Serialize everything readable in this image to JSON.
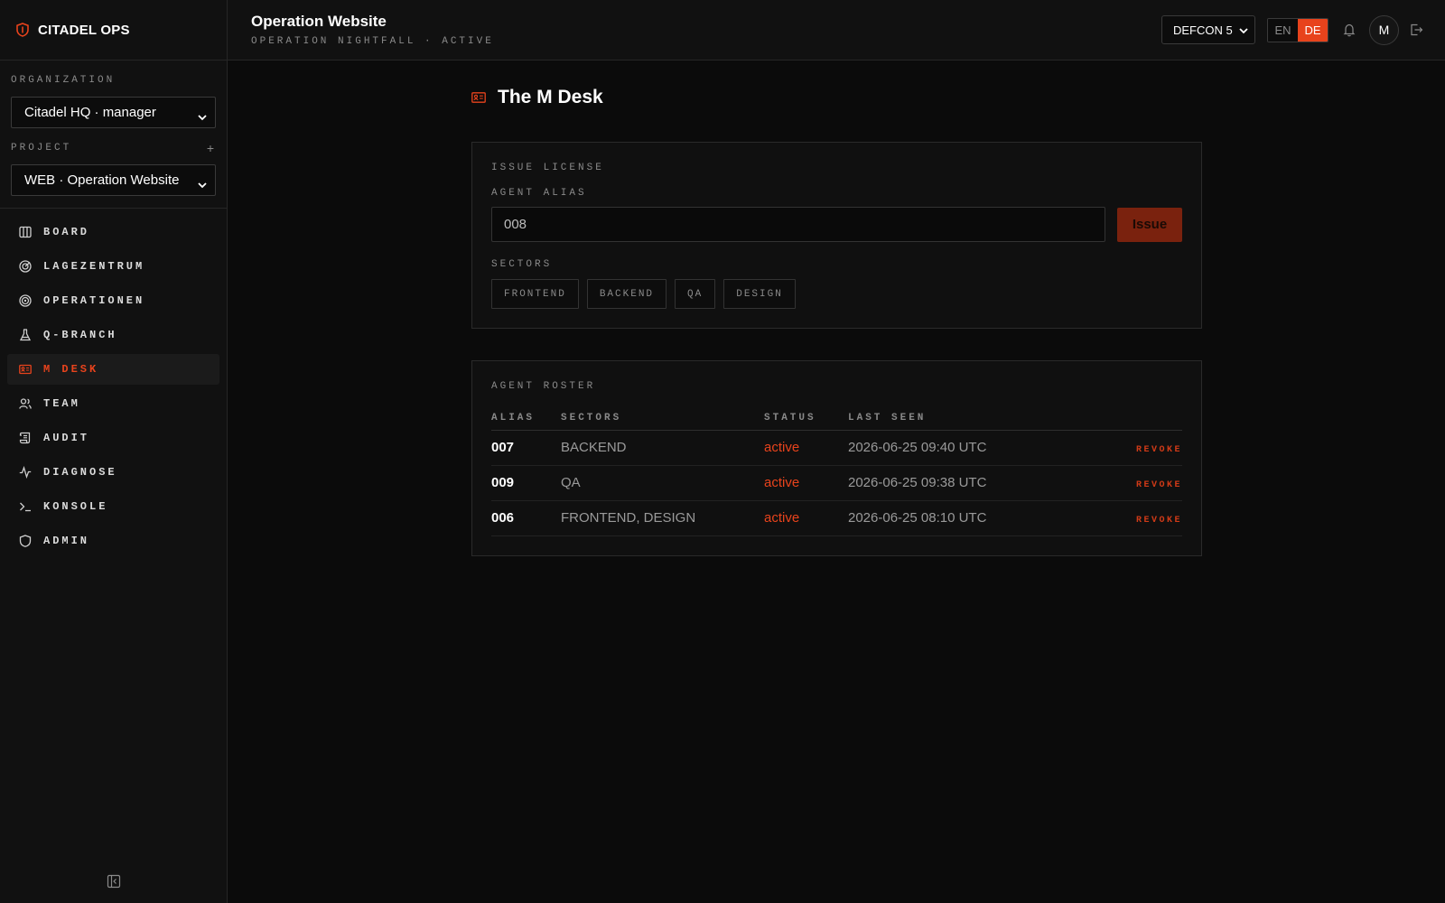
{
  "brand": {
    "name": "CITADEL OPS",
    "icon": "shield-icon"
  },
  "sidebar": {
    "org_label": "ORGANIZATION",
    "org_value": "Citadel HQ · manager",
    "project_label": "PROJECT",
    "project_add": "+",
    "project_value": "WEB · Operation Website",
    "items": [
      {
        "label": "BOARD",
        "icon": "board-columns-icon"
      },
      {
        "label": "LAGEZENTRUM",
        "icon": "radar-icon"
      },
      {
        "label": "OPERATIONEN",
        "icon": "target-icon"
      },
      {
        "label": "Q-BRANCH",
        "icon": "flask-icon"
      },
      {
        "label": "M DESK",
        "icon": "id-card-icon",
        "active": true
      },
      {
        "label": "TEAM",
        "icon": "users-icon"
      },
      {
        "label": "AUDIT",
        "icon": "scroll-icon"
      },
      {
        "label": "DIAGNOSE",
        "icon": "activity-icon"
      },
      {
        "label": "KONSOLE",
        "icon": "terminal-icon"
      },
      {
        "label": "ADMIN",
        "icon": "shield-icon"
      }
    ]
  },
  "topbar": {
    "title": "Operation Website",
    "subtitle": "OPERATION NIGHTFALL · ACTIVE",
    "defcon": "DEFCON 5",
    "lang_en": "EN",
    "lang_de": "DE",
    "avatar": "M"
  },
  "page": {
    "title": "The M Desk"
  },
  "issue": {
    "card_label": "ISSUE LICENSE",
    "alias_label": "AGENT ALIAS",
    "alias_value": "008",
    "button": "Issue",
    "sectors_label": "SECTORS",
    "sectors": [
      "FRONTEND",
      "BACKEND",
      "QA",
      "DESIGN"
    ]
  },
  "roster": {
    "card_label": "AGENT ROSTER",
    "headers": {
      "alias": "ALIAS",
      "sectors": "SECTORS",
      "status": "STATUS",
      "last_seen": "LAST SEEN"
    },
    "rows": [
      {
        "alias": "007",
        "sectors": "BACKEND",
        "status": "active",
        "last_seen": "2026-06-25 09:40 UTC",
        "action": "REVOKE"
      },
      {
        "alias": "009",
        "sectors": "QA",
        "status": "active",
        "last_seen": "2026-06-25 09:38 UTC",
        "action": "REVOKE"
      },
      {
        "alias": "006",
        "sectors": "FRONTEND, DESIGN",
        "status": "active",
        "last_seen": "2026-06-25 08:10 UTC",
        "action": "REVOKE"
      }
    ]
  },
  "colors": {
    "accent": "#e8431c",
    "background": "#0b0b0b",
    "panel": "#111111"
  }
}
